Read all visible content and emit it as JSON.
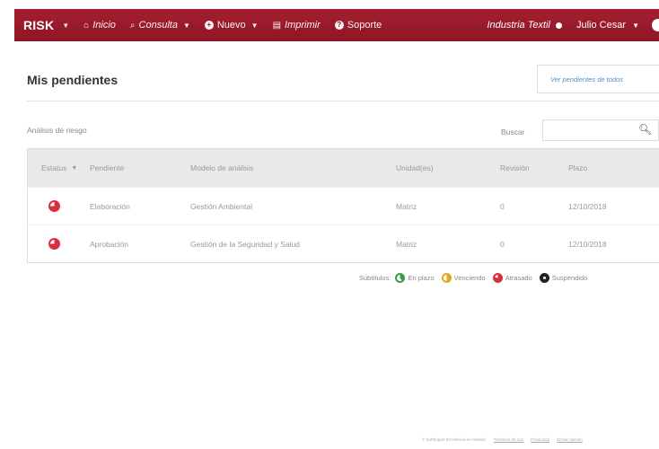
{
  "nav": {
    "brand": "RISK",
    "items": [
      {
        "label": "Inicio",
        "icon": "home-icon"
      },
      {
        "label": "Consulta",
        "icon": "search-icon"
      },
      {
        "label": "Nuevo",
        "icon": "plus-circle-icon"
      },
      {
        "label": "Imprimir",
        "icon": "print-icon"
      },
      {
        "label": "Soporte",
        "icon": "help-circle-icon"
      }
    ],
    "company": "Industria Textil",
    "user": "Julio Cesar"
  },
  "page": {
    "title": "Mis pendientes",
    "view_all_label": "Ver pendientes de todos"
  },
  "section": {
    "label": "Análisis de riesgo",
    "search_label": "Buscar"
  },
  "table": {
    "columns": [
      "Estatus",
      "Pendiente",
      "Modelo de análisis",
      "Unidad(es)",
      "Revisión",
      "Plazo"
    ],
    "rows": [
      {
        "status": "atrasado",
        "pendiente": "Elaboración",
        "modelo": "Gestión Ambiental",
        "unidad": "Matriz",
        "revision": "0",
        "plazo": "12/10/2018"
      },
      {
        "status": "atrasado",
        "pendiente": "Aprobación",
        "modelo": "Gestión de la Seguridad y Salud",
        "unidad": "Matriz",
        "revision": "0",
        "plazo": "12/10/2018"
      }
    ]
  },
  "legend": {
    "title": "Subtítulos:",
    "items": [
      "En plazo",
      "Venciendo",
      "Atrasado",
      "Suspendido"
    ]
  },
  "footer": {
    "links": [
      "© SoftExpert Excelencia en Gestión",
      "Términos de uso",
      "Privacidad",
      "Enviar opinión"
    ]
  },
  "colors": {
    "nav": "#8e1625",
    "accent_link": "#4a8cc9",
    "status_red": "#d93040",
    "status_green": "#3a9d4a",
    "status_yellow": "#e0a81c"
  }
}
